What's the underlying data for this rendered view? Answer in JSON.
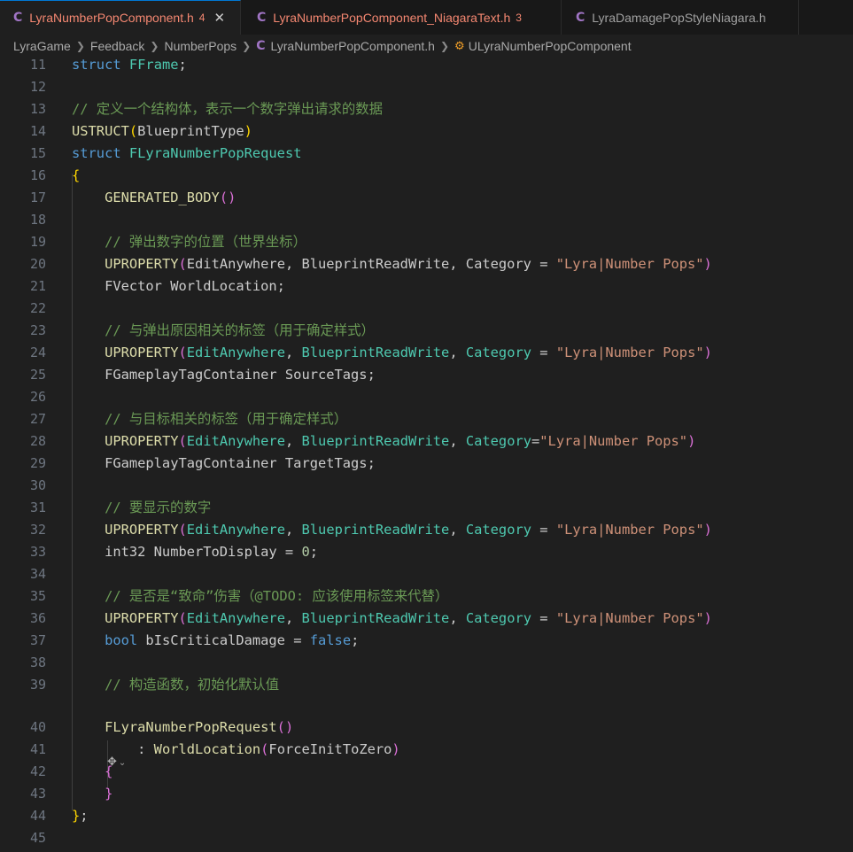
{
  "tabs": [
    {
      "icon": "C",
      "name": "LyraNumberPopComponent.h",
      "badge": "4",
      "close": "✕",
      "active": true
    },
    {
      "icon": "C",
      "name": "LyraNumberPopComponent_NiagaraText.h",
      "badge": "3",
      "active": false
    },
    {
      "icon": "C",
      "name": "LyraDamagePopStyleNiagara.h",
      "badge": "",
      "active": false
    }
  ],
  "breadcrumb": {
    "parts": [
      "LyraGame",
      "Feedback",
      "NumberPops"
    ],
    "file_icon": "C",
    "file": "LyraNumberPopComponent.h",
    "symbol": "ULyraNumberPopComponent"
  },
  "colors": {
    "keyword": "#569cd6",
    "type": "#4ec9b0",
    "macro": "#dcdcaa",
    "string": "#ce9178",
    "comment": "#6a9955",
    "number": "#b5cea8",
    "bracket1": "#ffd700",
    "bracket2": "#da70d6",
    "bracket3": "#179fff",
    "active_tab_accent": "#0078d4"
  },
  "codelens_icon": "sparkle-icon",
  "lines": [
    {
      "n": "11",
      "tokens": [
        [
          "kw",
          "struct"
        ],
        [
          "plain",
          " "
        ],
        [
          "type",
          "FFrame"
        ],
        [
          "plain",
          ";"
        ]
      ]
    },
    {
      "n": "12",
      "tokens": []
    },
    {
      "n": "13",
      "tokens": [
        [
          "com",
          "// 定义一个结构体，表示一个数字弹出请求的数据"
        ]
      ]
    },
    {
      "n": "14",
      "tokens": [
        [
          "macro",
          "USTRUCT"
        ],
        [
          "p1",
          "("
        ],
        [
          "plain",
          "BlueprintType"
        ],
        [
          "p1",
          ")"
        ]
      ]
    },
    {
      "n": "15",
      "tokens": [
        [
          "kw",
          "struct"
        ],
        [
          "plain",
          " "
        ],
        [
          "type",
          "FLyraNumberPopRequest"
        ]
      ]
    },
    {
      "n": "16",
      "tokens": [
        [
          "p1",
          "{"
        ]
      ]
    },
    {
      "n": "17",
      "tokens": [
        [
          "plain",
          "    "
        ],
        [
          "macro",
          "GENERATED_BODY"
        ],
        [
          "p2",
          "()"
        ]
      ]
    },
    {
      "n": "18",
      "tokens": []
    },
    {
      "n": "19",
      "tokens": [
        [
          "plain",
          "    "
        ],
        [
          "com",
          "// 弹出数字的位置（世界坐标）"
        ]
      ]
    },
    {
      "n": "20",
      "tokens": [
        [
          "plain",
          "    "
        ],
        [
          "macro",
          "UPROPERTY"
        ],
        [
          "p2",
          "("
        ],
        [
          "plain",
          "EditAnywhere, BlueprintReadWrite, Category = "
        ],
        [
          "str",
          "\"Lyra|Number Pops\""
        ],
        [
          "p2",
          ")"
        ]
      ]
    },
    {
      "n": "21",
      "tokens": [
        [
          "plain",
          "    FVector WorldLocation;"
        ]
      ]
    },
    {
      "n": "22",
      "tokens": []
    },
    {
      "n": "23",
      "tokens": [
        [
          "plain",
          "    "
        ],
        [
          "com",
          "// 与弹出原因相关的标签（用于确定样式）"
        ]
      ]
    },
    {
      "n": "24",
      "tokens": [
        [
          "plain",
          "    "
        ],
        [
          "macro",
          "UPROPERTY"
        ],
        [
          "p2",
          "("
        ],
        [
          "type",
          "EditAnywhere"
        ],
        [
          "plain",
          ", "
        ],
        [
          "type",
          "BlueprintReadWrite"
        ],
        [
          "plain",
          ", "
        ],
        [
          "type",
          "Category"
        ],
        [
          "plain",
          " = "
        ],
        [
          "str",
          "\"Lyra|Number Pops\""
        ],
        [
          "p2",
          ")"
        ]
      ]
    },
    {
      "n": "25",
      "tokens": [
        [
          "plain",
          "    FGameplayTagContainer SourceTags;"
        ]
      ]
    },
    {
      "n": "26",
      "tokens": []
    },
    {
      "n": "27",
      "tokens": [
        [
          "plain",
          "    "
        ],
        [
          "com",
          "// 与目标相关的标签（用于确定样式）"
        ]
      ]
    },
    {
      "n": "28",
      "tokens": [
        [
          "plain",
          "    "
        ],
        [
          "macro",
          "UPROPERTY"
        ],
        [
          "p2",
          "("
        ],
        [
          "type",
          "EditAnywhere"
        ],
        [
          "plain",
          ", "
        ],
        [
          "type",
          "BlueprintReadWrite"
        ],
        [
          "plain",
          ", "
        ],
        [
          "type",
          "Category"
        ],
        [
          "plain",
          "="
        ],
        [
          "str",
          "\"Lyra|Number Pops\""
        ],
        [
          "p2",
          ")"
        ]
      ]
    },
    {
      "n": "29",
      "tokens": [
        [
          "plain",
          "    FGameplayTagContainer TargetTags;"
        ]
      ]
    },
    {
      "n": "30",
      "tokens": []
    },
    {
      "n": "31",
      "tokens": [
        [
          "plain",
          "    "
        ],
        [
          "com",
          "// 要显示的数字"
        ]
      ]
    },
    {
      "n": "32",
      "tokens": [
        [
          "plain",
          "    "
        ],
        [
          "macro",
          "UPROPERTY"
        ],
        [
          "p2",
          "("
        ],
        [
          "type",
          "EditAnywhere"
        ],
        [
          "plain",
          ", "
        ],
        [
          "type",
          "BlueprintReadWrite"
        ],
        [
          "plain",
          ", "
        ],
        [
          "type",
          "Category"
        ],
        [
          "plain",
          " = "
        ],
        [
          "str",
          "\"Lyra|Number Pops\""
        ],
        [
          "p2",
          ")"
        ]
      ]
    },
    {
      "n": "33",
      "tokens": [
        [
          "plain",
          "    int32 NumberToDisplay = "
        ],
        [
          "num",
          "0"
        ],
        [
          "plain",
          ";"
        ]
      ]
    },
    {
      "n": "34",
      "tokens": []
    },
    {
      "n": "35",
      "tokens": [
        [
          "plain",
          "    "
        ],
        [
          "com",
          "// 是否是“致命”伤害（@TODO: 应该使用标签来代替）"
        ]
      ]
    },
    {
      "n": "36",
      "tokens": [
        [
          "plain",
          "    "
        ],
        [
          "macro",
          "UPROPERTY"
        ],
        [
          "p2",
          "("
        ],
        [
          "type",
          "EditAnywhere"
        ],
        [
          "plain",
          ", "
        ],
        [
          "type",
          "BlueprintReadWrite"
        ],
        [
          "plain",
          ", "
        ],
        [
          "type",
          "Category"
        ],
        [
          "plain",
          " = "
        ],
        [
          "str",
          "\"Lyra|Number Pops\""
        ],
        [
          "p2",
          ")"
        ]
      ]
    },
    {
      "n": "37",
      "tokens": [
        [
          "plain",
          "    "
        ],
        [
          "kw",
          "bool"
        ],
        [
          "plain",
          " bIsCriticalDamage = "
        ],
        [
          "kw",
          "false"
        ],
        [
          "plain",
          ";"
        ]
      ]
    },
    {
      "n": "38",
      "tokens": []
    },
    {
      "n": "39",
      "tokens": [
        [
          "plain",
          "    "
        ],
        [
          "com",
          "// 构造函数，初始化默认值"
        ]
      ]
    },
    {
      "n": "40",
      "tokens": [
        [
          "plain",
          "    "
        ],
        [
          "fn",
          "FLyraNumberPopRequest"
        ],
        [
          "p2",
          "()"
        ]
      ]
    },
    {
      "n": "41",
      "tokens": [
        [
          "plain",
          "        : "
        ],
        [
          "fn",
          "WorldLocation"
        ],
        [
          "p2",
          "("
        ],
        [
          "plain",
          "ForceInitToZero"
        ],
        [
          "p2",
          ")"
        ]
      ]
    },
    {
      "n": "42",
      "tokens": [
        [
          "plain",
          "    "
        ],
        [
          "p2",
          "{"
        ]
      ]
    },
    {
      "n": "43",
      "tokens": [
        [
          "plain",
          "    "
        ],
        [
          "p2",
          "}"
        ]
      ]
    },
    {
      "n": "44",
      "tokens": [
        [
          "p1",
          "}"
        ],
        [
          "plain",
          ";"
        ]
      ]
    },
    {
      "n": "45",
      "tokens": []
    }
  ]
}
